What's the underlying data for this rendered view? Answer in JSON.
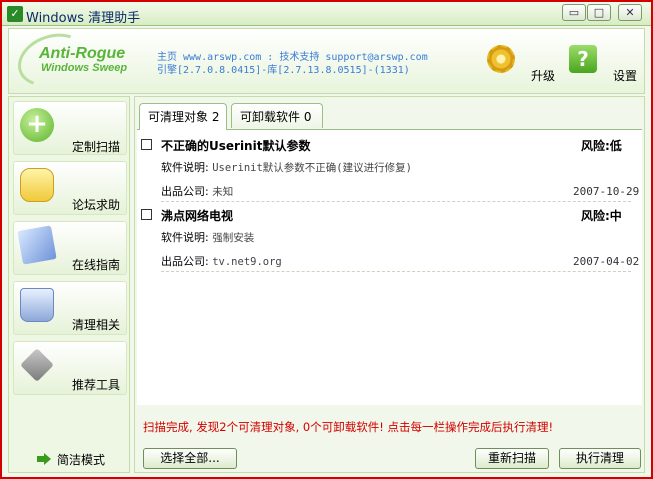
{
  "window": {
    "title": "Windows 清理助手",
    "icon": "broom-app-icon"
  },
  "title_buttons": {
    "minimize": "▭",
    "maximize": "□",
    "close": "✕"
  },
  "header": {
    "logo_title": "Anti-Rogue",
    "logo_subtitle": "Windows Sweep",
    "info_line1": "主页 www.arswp.com : 技术支持 support@arswp.com",
    "info_line2": "引擎[2.7.0.8.0415]-库[2.7.13.8.0515]-(1331)",
    "upgrade_label": "升级",
    "settings_label": "设置"
  },
  "sidebar": {
    "items": [
      {
        "label": "定制扫描",
        "icon": "plus-icon"
      },
      {
        "label": "论坛求助",
        "icon": "chat-bubble-icon"
      },
      {
        "label": "在线指南",
        "icon": "guide-book-icon"
      },
      {
        "label": "清理相关",
        "icon": "recycle-bin-icon"
      },
      {
        "label": "推荐工具",
        "icon": "tools-icon"
      }
    ],
    "simple_mode_label": "简洁模式"
  },
  "tabs": [
    {
      "label": "可清理对象 2",
      "active": true
    },
    {
      "label": "可卸载软件 0",
      "active": false
    }
  ],
  "entries": [
    {
      "name": "不正确的Userinit默认参数",
      "risk": "风险:低",
      "desc_label": "软件说明:",
      "desc": "Userinit默认参数不正确(建议进行修复)",
      "company_label": "出品公司:",
      "company": "未知",
      "date": "2007-10-29"
    },
    {
      "name": "沸点网络电视",
      "risk": "风险:中",
      "desc_label": "软件说明:",
      "desc": "强制安装",
      "company_label": "出品公司:",
      "company": "tv.net9.org",
      "date": "2007-04-02"
    }
  ],
  "status_text": "扫描完成, 发现2个可清理对象, 0个可卸载软件! 点击每一栏操作完成后执行清理!",
  "buttons": {
    "select_all": "选择全部...",
    "rescan": "重新扫描",
    "clean": "执行清理"
  },
  "colors": {
    "accent": "#58b53a",
    "status": "#d40000",
    "link": "#3a7bd5"
  }
}
